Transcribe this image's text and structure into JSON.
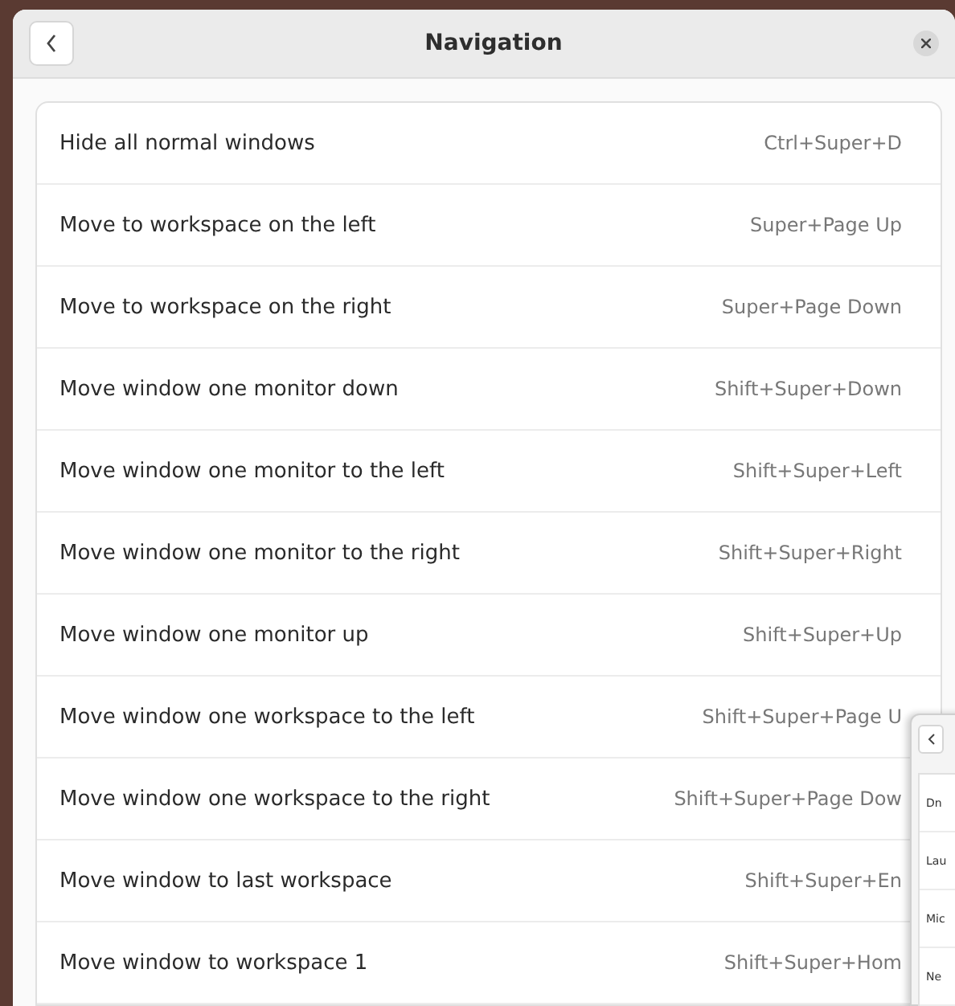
{
  "window": {
    "title": "Navigation"
  },
  "shortcuts": [
    {
      "action": "Hide all normal windows",
      "keys": "Ctrl+Super+D"
    },
    {
      "action": "Move to workspace on the left",
      "keys": "Super+Page Up"
    },
    {
      "action": "Move to workspace on the right",
      "keys": "Super+Page Down"
    },
    {
      "action": "Move window one monitor down",
      "keys": "Shift+Super+Down"
    },
    {
      "action": "Move window one monitor to the left",
      "keys": "Shift+Super+Left"
    },
    {
      "action": "Move window one monitor to the right",
      "keys": "Shift+Super+Right"
    },
    {
      "action": "Move window one monitor up",
      "keys": "Shift+Super+Up"
    },
    {
      "action": "Move window one workspace to the left",
      "keys": "Shift+Super+Page U"
    },
    {
      "action": "Move window one workspace to the right",
      "keys": "Shift+Super+Page Dow"
    },
    {
      "action": "Move window to last workspace",
      "keys": "Shift+Super+En"
    },
    {
      "action": "Move window to workspace 1",
      "keys": "Shift+Super+Hom"
    }
  ],
  "second_window": {
    "rows": [
      "Dn",
      "Lau",
      "Mic",
      "Ne"
    ]
  }
}
